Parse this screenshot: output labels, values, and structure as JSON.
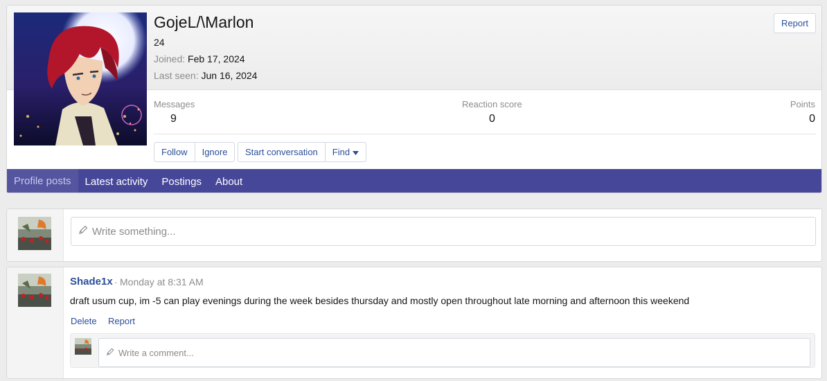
{
  "profile": {
    "username": "GojeL/\\Marlon",
    "user_title": "24",
    "joined_label": "Joined:",
    "joined_value": "Feb 17, 2024",
    "last_seen_label": "Last seen:",
    "last_seen_value": "Jun 16, 2024",
    "report_label": "Report"
  },
  "stats": {
    "messages_label": "Messages",
    "messages_value": "9",
    "reaction_label": "Reaction score",
    "reaction_value": "0",
    "points_label": "Points",
    "points_value": "0"
  },
  "actions": {
    "follow": "Follow",
    "ignore": "Ignore",
    "start_conversation": "Start conversation",
    "find": "Find"
  },
  "tabs": [
    {
      "label": "Profile posts",
      "active": true
    },
    {
      "label": "Latest activity",
      "active": false
    },
    {
      "label": "Postings",
      "active": false
    },
    {
      "label": "About",
      "active": false
    }
  ],
  "composer": {
    "placeholder": "Write something..."
  },
  "post": {
    "author": "Shade1x",
    "separator": "·",
    "time": "Monday at 8:31 AM",
    "text": "draft usum cup, im -5 can play evenings during the week besides thursday and mostly open throughout late morning and afternoon this weekend",
    "delete_label": "Delete",
    "report_label": "Report",
    "comment_placeholder": "Write a comment..."
  },
  "colors": {
    "accent": "#47479a",
    "link": "#2b4e9b",
    "muted": "#8c8c8c"
  },
  "icons": [
    "pencil-icon",
    "caret-down-icon"
  ]
}
